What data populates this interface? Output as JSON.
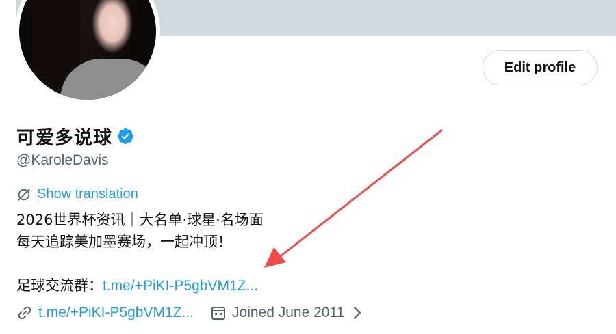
{
  "profile": {
    "display_name": "可爱多说球",
    "handle": "@KaroleDavis",
    "edit_button_label": "Edit profile",
    "translate_label": "Show translation",
    "bio_line1": "2026世界杯资讯｜大名单·球星·名场面",
    "bio_line2": "每天追踪美加墨赛场，一起冲顶！",
    "bio_group_label": "足球交流群：",
    "bio_group_link": "t.me/+PiKI-P5gbVM1Z...",
    "website_link": "t.me/+PiKI-P5gbVM1Z...",
    "joined": "Joined June 2011"
  },
  "colors": {
    "accent": "#1d9bf0",
    "banner": "#cfd9de",
    "muted": "#536471",
    "annotation_arrow": "#f04a4a"
  },
  "icons": [
    "verified-badge-icon",
    "translate-icon",
    "link-icon",
    "calendar-icon",
    "chevron-right-icon",
    "annotation-arrow"
  ]
}
